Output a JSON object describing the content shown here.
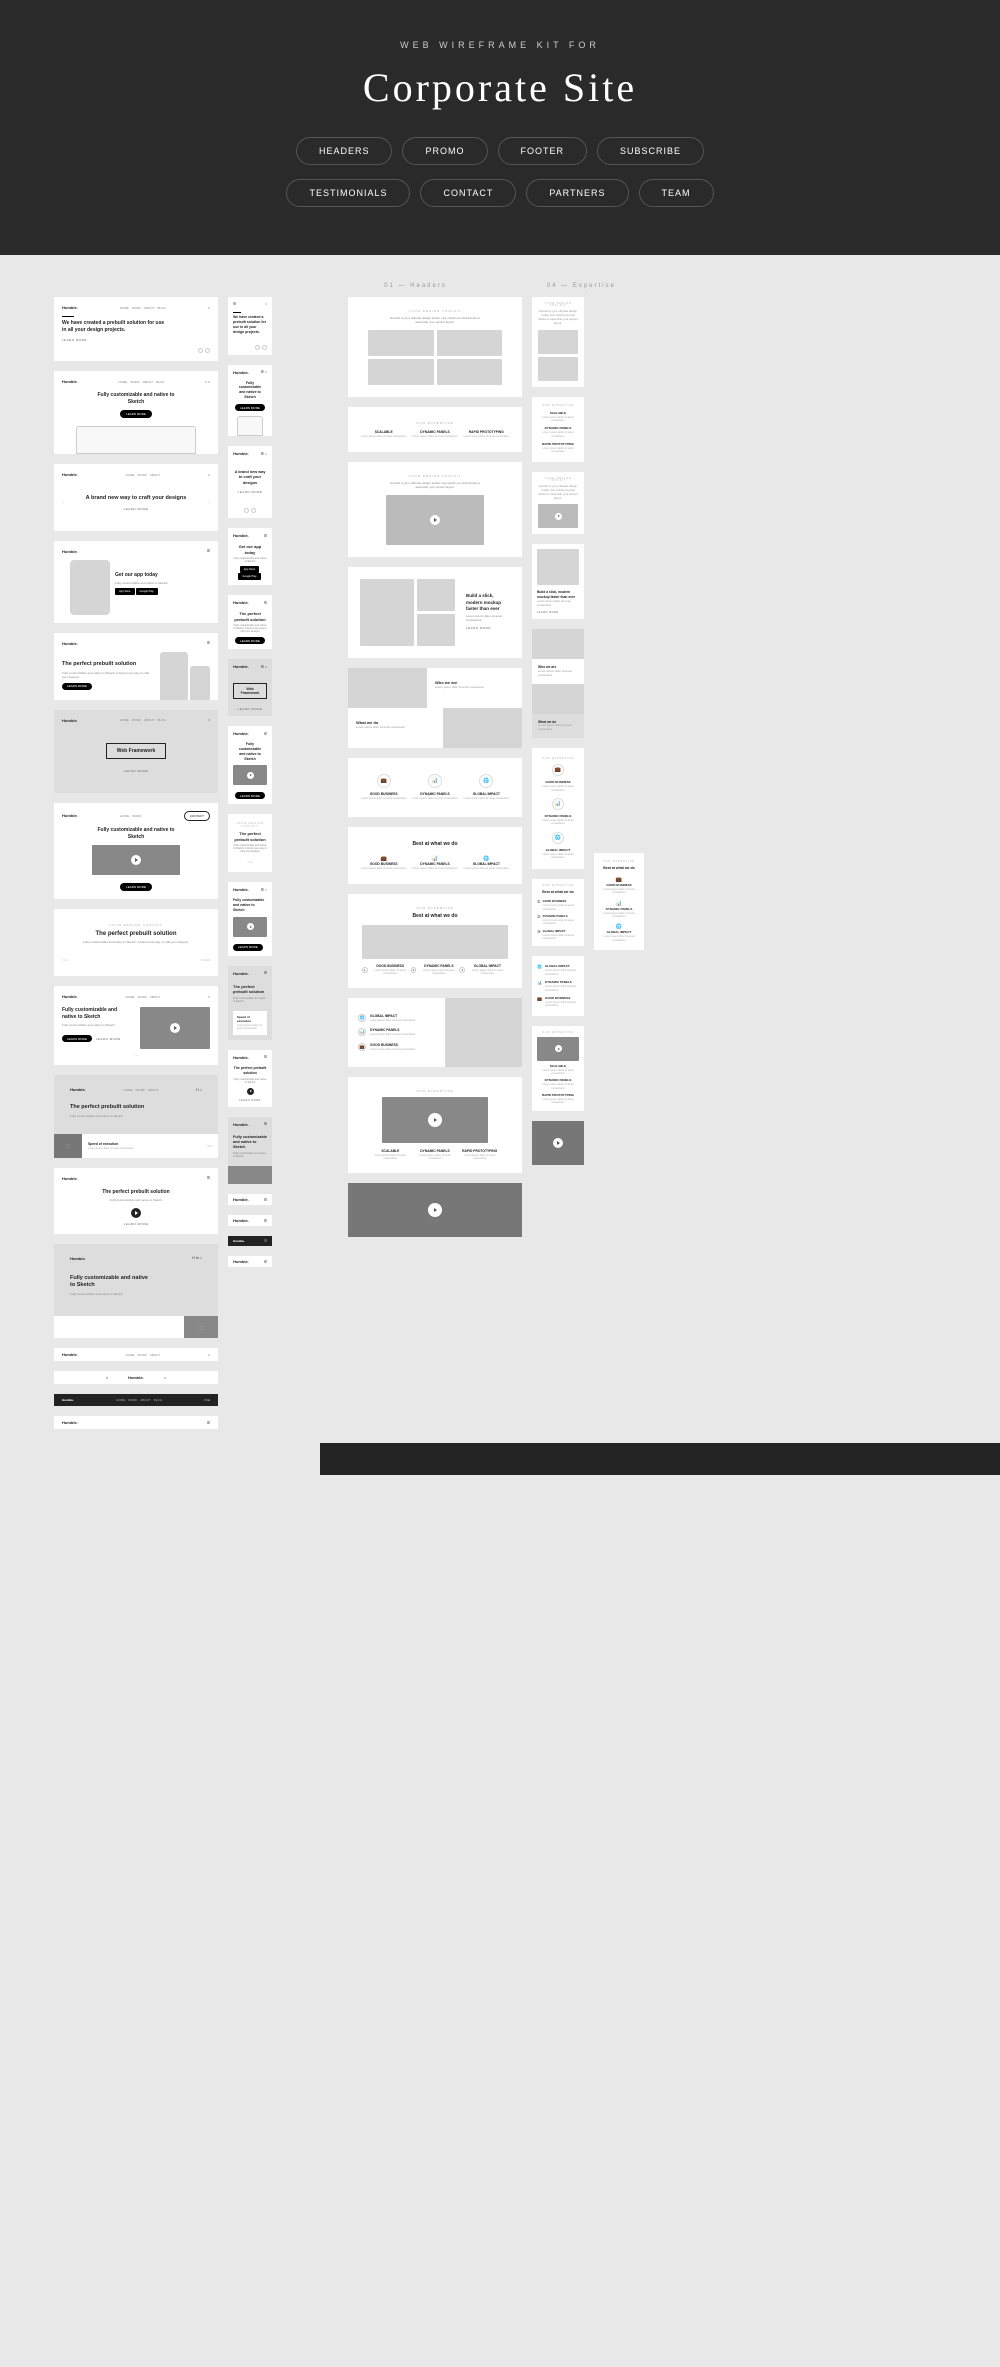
{
  "hero": {
    "kicker": "WEB WIREFRAME KIT FOR",
    "title": "Corporate Site",
    "pills1": [
      "HEADERS",
      "PROMO",
      "FOOTER",
      "SUBSCRIBE"
    ],
    "pills2": [
      "TESTIMONIALS",
      "CONTACT",
      "PARTNERS",
      "TEAM"
    ]
  },
  "labels": {
    "headers": "01 — Headers",
    "expertise": "04 — Expertise",
    "logo": "Humble.",
    "learn": "LEARN MORE",
    "eyebrow": "YOUR DESIGN TOOLKIT",
    "expertise_eye": "OUR EXPERTISE",
    "nav_home": "HOME",
    "nav_work": "WORK",
    "nav_about": "ABOUT",
    "nav_blog": "BLOG"
  },
  "h": {
    "h1": "We have created a prebuilt solution for use in all your design projects.",
    "h2": "Fully customizable and native to Sketch",
    "h3": "A brand new way to craft your designs",
    "h4": "Get our app today",
    "h4s": "Fully customizable and native to Sketch",
    "h5": "The perfect prebuilt solution",
    "h5s": "Fully customizable and native to Sketch. A brand new way to craft your designs.",
    "h6": "Web Framework",
    "h8": "The perfect prebuilt solution",
    "app1": "App Store",
    "app2": "Google Play"
  },
  "e": {
    "intro": "Humble is your ultimate design toolkit. Use stylish pre-built blocks to assemble your perfect layout.",
    "scalable": "SCALABLE",
    "dynamic": "DYNAMIC PANELS",
    "rapid": "RAPID PROTOTYPING",
    "good": "GOOD BUSINESS",
    "global": "GLOBAL IMPACT",
    "best": "Best at what we do",
    "who": "Who we are",
    "what": "What we do",
    "mock": "Build a slick, modern mockup faster than ever",
    "lorem": "Lorem ipsum dolor sit amet consectetur"
  }
}
